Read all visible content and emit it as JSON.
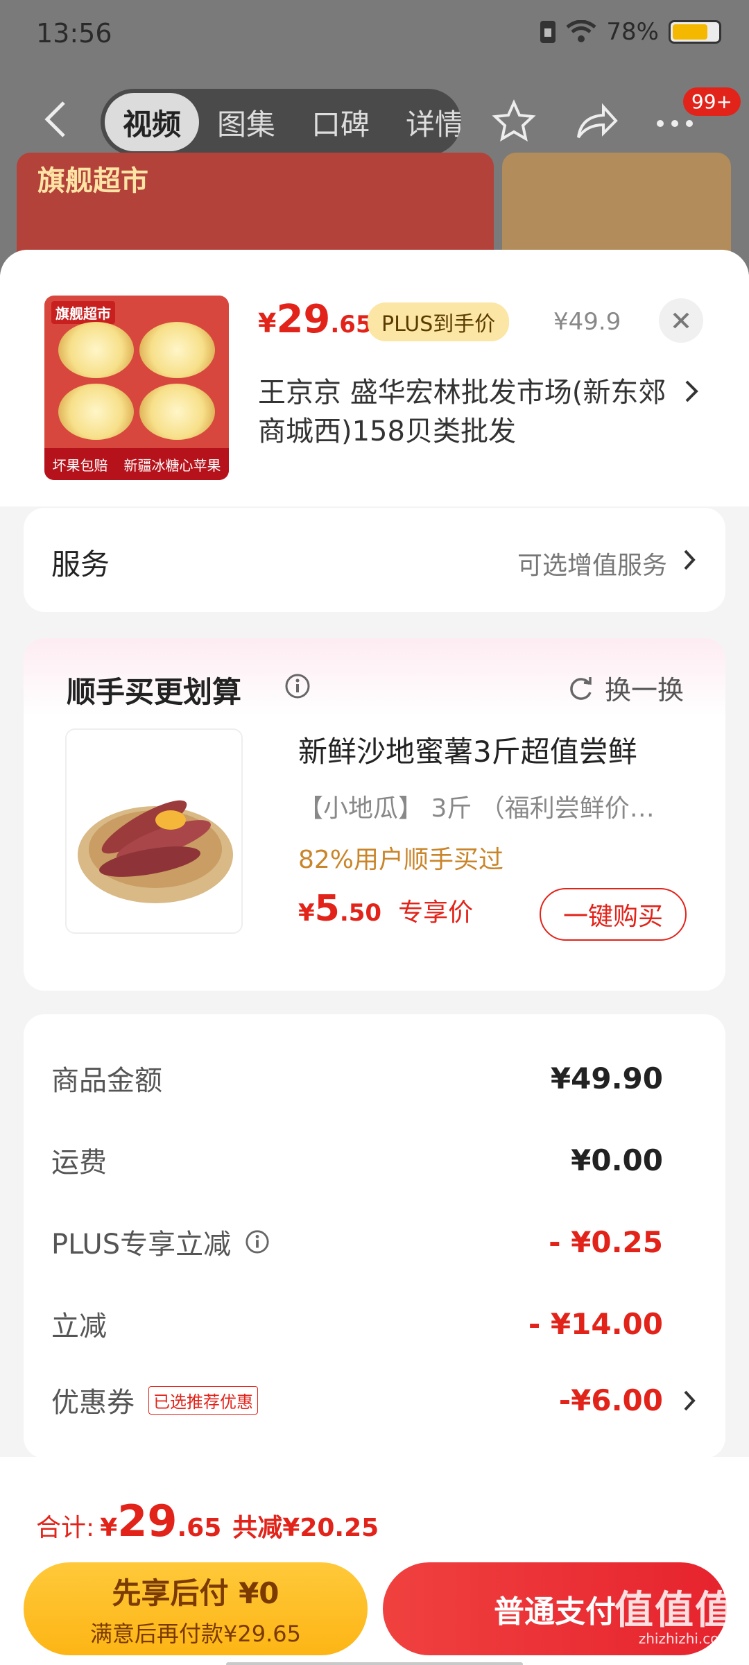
{
  "status": {
    "time": "13:56",
    "battery": "78%",
    "battery_level": 0.78
  },
  "nav": {
    "tabs": [
      "视频",
      "图集",
      "口碑",
      "详情"
    ],
    "active_tab": 0,
    "badge": "99+"
  },
  "background": {
    "brand": "旗舰超市"
  },
  "sku": {
    "thumb_tag": "旗舰超市",
    "thumb_footer": [
      "坏果包赔",
      "新疆冰糖心苹果"
    ],
    "price_currency": "¥",
    "price_int": "29",
    "price_dec": ".65",
    "plus_label": "PLUS到手价",
    "original_price": "¥49.9",
    "store": "王京京  盛华宏林批发市场(新东郊商城西)158贝类批发"
  },
  "service": {
    "label": "服务",
    "value": "可选增值服务"
  },
  "bundle": {
    "title": "顺手买更划算",
    "swap_label": "换一换",
    "product_title": "新鲜沙地蜜薯3斤超值尝鲜",
    "product_spec": "【小地瓜】 3斤 （福利尝鲜价…",
    "social_proof": "82%用户顺手买过",
    "price_currency": "¥",
    "price_int": "5",
    "price_dec": ".50",
    "price_note": "专享价",
    "buy_label": "一键购买"
  },
  "summary": {
    "rows": [
      {
        "label": "商品金额",
        "value": "¥49.90"
      },
      {
        "label": "运费",
        "value": "¥0.00"
      },
      {
        "label": "PLUS专享立减",
        "value": "- ¥0.25"
      },
      {
        "label": "立减",
        "value": "- ¥14.00"
      },
      {
        "label": "优惠券",
        "tag": "已选推荐优惠",
        "value": "-¥6.00"
      }
    ]
  },
  "footer": {
    "total_label": "合计:",
    "total_currency": "¥",
    "total_int": "29",
    "total_dec": ".65",
    "savings": "共减¥20.25",
    "pay_later_line1": "先享后付 ¥0",
    "pay_later_line2": "满意后再付款¥29.65",
    "pay_now": "普通支付",
    "watermark": "值值值",
    "watermark_sub": "zhizhizhi.com"
  },
  "colors": {
    "accent_red": "#e2231a",
    "plus_gold": "#fbe6a6",
    "pay_later_yellow": "#fdb515"
  },
  "icons": [
    "back-icon",
    "star-icon",
    "share-icon",
    "more-icon",
    "close-icon",
    "chevron-right-icon",
    "info-icon",
    "refresh-icon",
    "wifi-icon",
    "sim-icon"
  ]
}
